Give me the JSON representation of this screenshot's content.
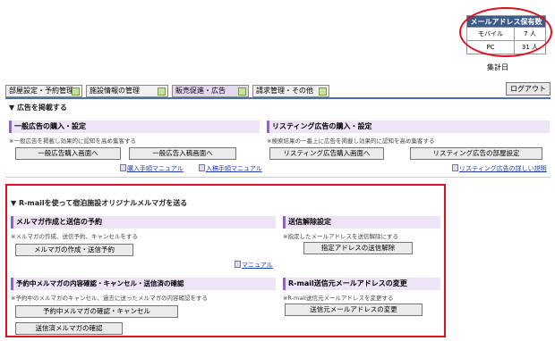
{
  "mail_count": {
    "title": "メールアドレス保有数",
    "rows": [
      {
        "label": "モバイル",
        "value": "7 人"
      },
      {
        "label": "PC",
        "value": "31 人"
      }
    ],
    "footer": "集計日"
  },
  "tabs": [
    {
      "label": "部屋設定・予約管理"
    },
    {
      "label": "施設情報の管理"
    },
    {
      "label": "販売促進・広告"
    },
    {
      "label": "請求管理・その他"
    }
  ],
  "logout_label": "ログアウト",
  "ads": {
    "heading": "▼ 広告を掲載する",
    "general": {
      "title": "一般広告の購入・設定",
      "note": "※一般広告を掲載し効果的に認知を高め集客する",
      "buttons": [
        "一般広告購入画面へ",
        "一般広告入稿画面へ"
      ]
    },
    "listing": {
      "title": "リスティング広告の購入・設定",
      "note": "※検索結果の一番上に広告を掲載し効果的に認知を高め集客する",
      "buttons": [
        "リスティング広告購入画面へ",
        "リスティング広告の部屋設定"
      ]
    },
    "links": [
      "購入手順マニュアル",
      "入稿手順マニュアル"
    ],
    "listing_link": "リスティング広告の詳しい説明"
  },
  "rmail": {
    "heading": "▼ R-mailを使って宿泊施設オリジナルメルマガを送る",
    "create": {
      "title": "メルマガ作成と送信の予約",
      "note": "※メルマガの作成、送信予約、キャンセルをする",
      "button": "メルマガの作成・送信予約"
    },
    "unsubscribe": {
      "title": "送信解除設定",
      "note": "※指定したメールアドレスを送信解除にする",
      "button": "指定アドレスの送信解除"
    },
    "manual_link": "マニュアル",
    "confirm": {
      "title": "予約中メルマガの内容確認・キャンセル・送信済の確認",
      "note": "※予約中のメルマガのキャンセル、過去に送ったメルマガの内容確認をする",
      "buttons": [
        "予約中メルマガの確認・キャンセル",
        "送信済メルマガの確認"
      ]
    },
    "sender": {
      "title": "R-mail送信元メールアドレスの変更",
      "note": "※R-mail送信元メールアドレスを変更する",
      "button": "送信元メールアドレスの変更"
    }
  },
  "colors": {
    "accent": "#4a6eb8",
    "highlight": "#e01020",
    "panel": "#eee4f6"
  }
}
